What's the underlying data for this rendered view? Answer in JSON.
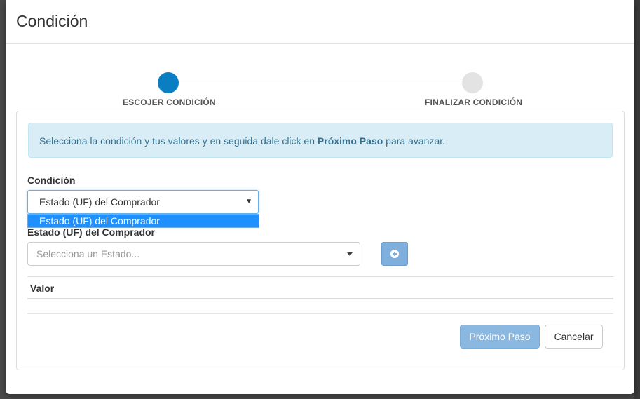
{
  "modal": {
    "title": "Condición"
  },
  "stepper": {
    "steps": [
      {
        "label": "ESCOJER CONDICIÓN",
        "active": true
      },
      {
        "label": "FINALIZAR CONDICIÓN",
        "active": false
      }
    ]
  },
  "alert": {
    "text_before": "Selecciona la condición y tus valores y en seguida dale click en ",
    "bold": "Próximo Paso",
    "text_after": " para avanzar."
  },
  "condition": {
    "label": "Condición",
    "selected": "Estado (UF) del Comprador",
    "options": [
      "Estado (UF) del Comprador"
    ]
  },
  "state": {
    "label": "Estado (UF) del Comprador",
    "placeholder": "Selecciona un Estado..."
  },
  "table": {
    "column_value": "Valor"
  },
  "footer": {
    "next_label": "Próximo Paso",
    "cancel_label": "Cancelar"
  },
  "colors": {
    "accent": "#0a7ec2",
    "alert_bg": "#d9edf7",
    "alert_text": "#31708f",
    "dropdown_highlight": "#1e90ff",
    "disabled_primary": "#8ab8e0"
  },
  "icons": {
    "add": "plus-circle-icon",
    "select_caret": "caret-down-icon"
  }
}
